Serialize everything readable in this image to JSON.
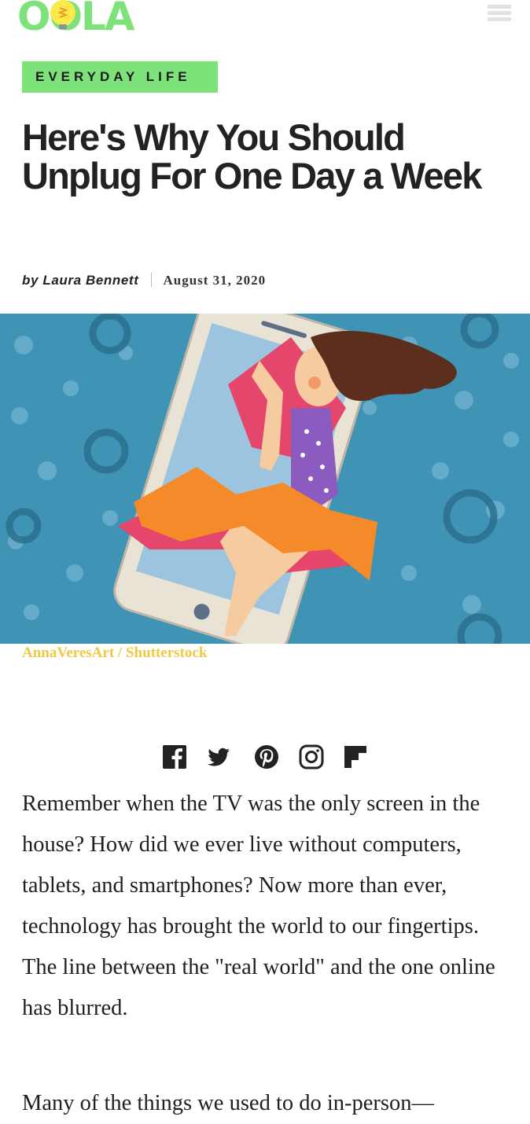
{
  "header": {
    "logo_text": "OOLA",
    "menu_icon": "hamburger-menu-icon"
  },
  "article": {
    "category": "EVERYDAY LIFE",
    "title": "Here's Why You Should Unplug For One Day a Week",
    "byline": "by Laura Bennett",
    "date": "August 31, 2020",
    "image_credit": "AnnaVeresArt / Shutterstock",
    "paragraphs": [
      "Remember when the TV was the only screen in the house? How did we ever live without computers, tablets, and smartphones? Now more than ever, technology has brought the world to our fingertips. The line between the \"real world\" and the one online has blurred.",
      "Many of the things we used to do in-person—"
    ]
  },
  "social": {
    "icons": [
      "facebook-icon",
      "twitter-icon",
      "pinterest-icon",
      "instagram-icon",
      "flipboard-icon"
    ]
  },
  "colors": {
    "accent_green": "#7ee27a",
    "credit_gold": "#f2c842",
    "hero_blue": "#3f93b5",
    "text_dark": "#222222"
  }
}
